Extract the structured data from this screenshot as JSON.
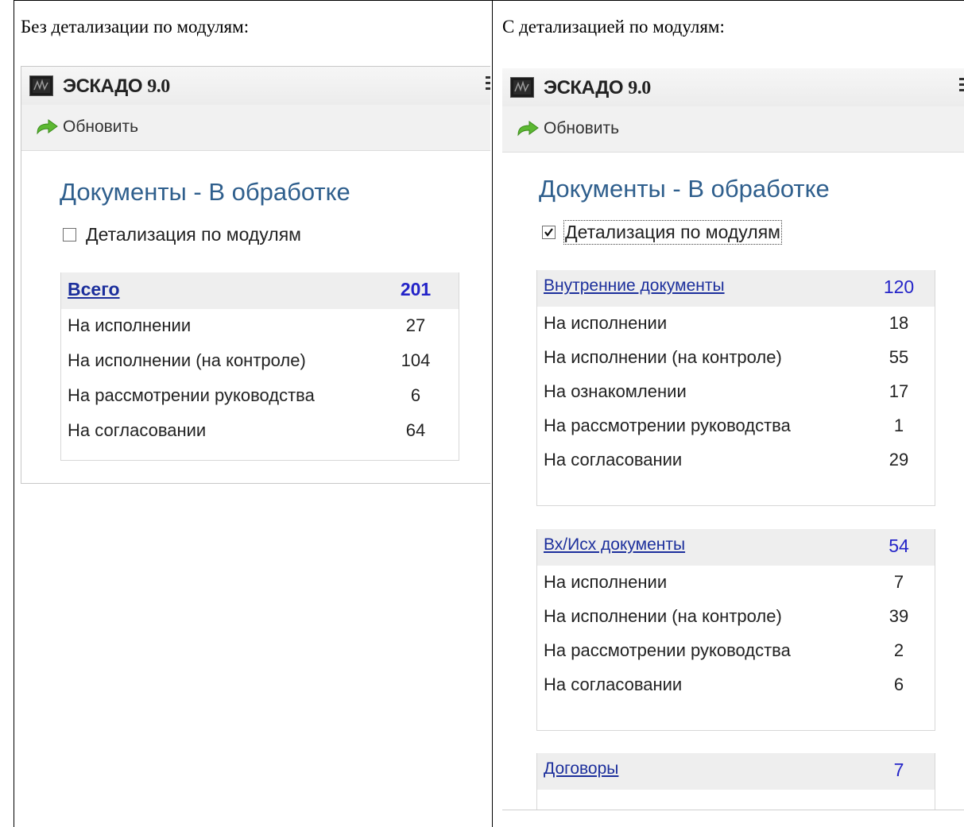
{
  "captions": {
    "left": "Без детализации по модулям:",
    "right": "С детализацией по модулям:"
  },
  "app": {
    "name": "ЭСКАДО",
    "version": "9.0",
    "logo_icon": "eskado-logo-icon",
    "menu_icon": "menu-icon"
  },
  "toolbar": {
    "refresh_label": "Обновить",
    "refresh_icon": "refresh-arrow-icon"
  },
  "left_panel": {
    "heading": "Документы - В обработке",
    "checkbox_label": "Детализация по модулям",
    "checkbox_checked": false,
    "table": {
      "title": "Всего",
      "total": "201",
      "rows": [
        {
          "label": "На исполнении",
          "value": "27"
        },
        {
          "label": "На исполнении (на контроле)",
          "value": "104"
        },
        {
          "label": "На рассмотрении руководства",
          "value": "6"
        },
        {
          "label": "На согласовании",
          "value": "64"
        }
      ]
    }
  },
  "right_panel": {
    "heading": "Документы - В обработке",
    "checkbox_label": "Детализация по модулям",
    "checkbox_checked": true,
    "groups": [
      {
        "title": "Внутренние документы",
        "total": "120",
        "rows": [
          {
            "label": "На исполнении",
            "value": "18"
          },
          {
            "label": "На исполнении (на контроле)",
            "value": "55"
          },
          {
            "label": "На ознакомлении",
            "value": "17"
          },
          {
            "label": "На рассмотрении руководства",
            "value": "1"
          },
          {
            "label": "На согласовании",
            "value": "29"
          }
        ]
      },
      {
        "title": "Вх/Исх документы",
        "total": "54",
        "rows": [
          {
            "label": "На исполнении",
            "value": "7"
          },
          {
            "label": "На исполнении (на контроле)",
            "value": "39"
          },
          {
            "label": "На рассмотрении руководства",
            "value": "2"
          },
          {
            "label": "На согласовании",
            "value": "6"
          }
        ]
      },
      {
        "title": "Договоры",
        "total": "7",
        "rows": []
      }
    ]
  },
  "colors": {
    "heading": "#2f5f8d",
    "link": "#1c2f9c",
    "count": "#2424c8",
    "table_header_bg": "#eeeeee"
  }
}
